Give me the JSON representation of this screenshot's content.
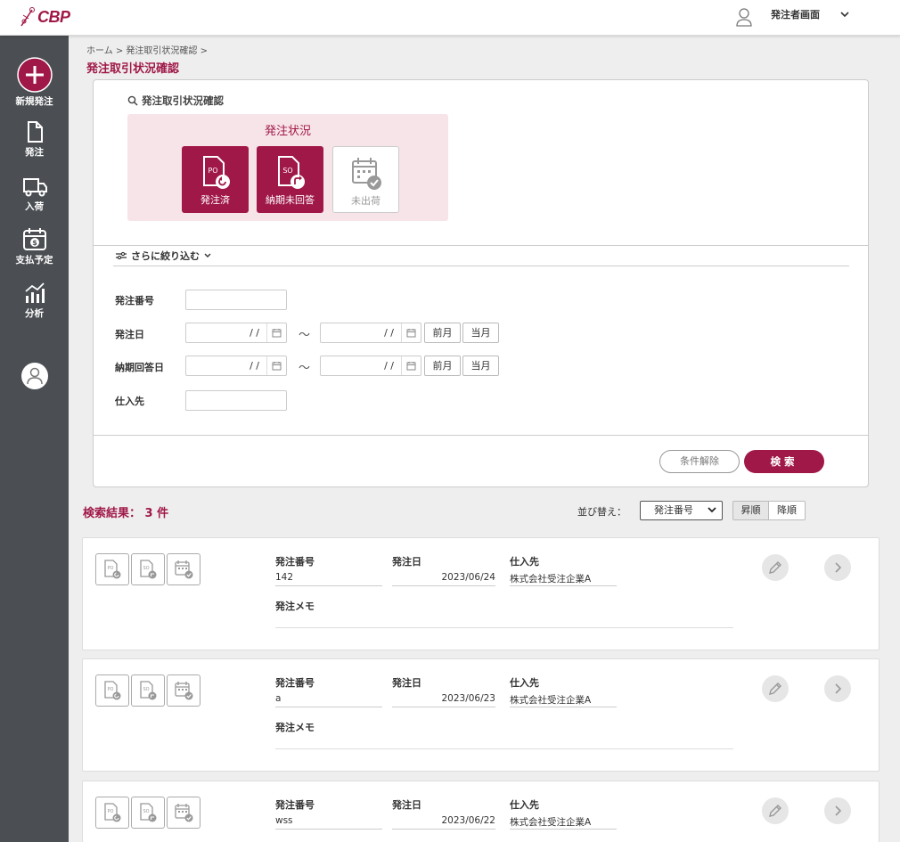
{
  "header": {
    "logo_text": "CBP",
    "user_label": "発注者画面"
  },
  "sidebar": {
    "items": [
      {
        "label": "新規発注",
        "icon": "plus-circle-icon"
      },
      {
        "label": "発注",
        "icon": "document-icon"
      },
      {
        "label": "入荷",
        "icon": "truck-icon"
      },
      {
        "label": "支払予定",
        "icon": "calendar-dollar-icon"
      },
      {
        "label": "分析",
        "icon": "chart-icon"
      }
    ]
  },
  "breadcrumb": "ホーム > 発注取引状況確認 >",
  "page_title": "発注取引状況確認",
  "search": {
    "title": "発注取引状況確認",
    "status_title": "発注状況",
    "status_buttons": [
      {
        "label": "発注済",
        "badge": "PO",
        "active": true
      },
      {
        "label": "納期未回答",
        "badge": "SO",
        "active": true
      },
      {
        "label": "未出荷",
        "active": false
      }
    ],
    "filter_toggle": "さらに絞り込む",
    "fields": {
      "order_number": "発注番号",
      "order_date": "発注日",
      "delivery_answer_date": "納期回答日",
      "supplier": "仕入先"
    },
    "date_placeholder": "/ /",
    "tilde": "～",
    "prev_month": "前月",
    "this_month": "当月",
    "clear_button": "条件解除",
    "search_button": "検索"
  },
  "results": {
    "count_label": "検索結果： 3 件",
    "sort_label": "並び替え：",
    "sort_selected": "発注番号",
    "ascending": "昇順",
    "descending": "降順",
    "labels": {
      "order_number": "発注番号",
      "order_date": "発注日",
      "supplier": "仕入先",
      "memo": "発注メモ"
    },
    "rows": [
      {
        "order_number": "142",
        "order_date": "2023/06/24",
        "supplier": "株式会社受注企業A"
      },
      {
        "order_number": "a",
        "order_date": "2023/06/23",
        "supplier": "株式会社受注企業A"
      },
      {
        "order_number": "wss",
        "order_date": "2023/06/22",
        "supplier": "株式会社受注企業A"
      }
    ]
  },
  "colors": {
    "brand": "#a01848",
    "sidebar": "#4b4f53",
    "status_bg": "#f7e4e8"
  }
}
